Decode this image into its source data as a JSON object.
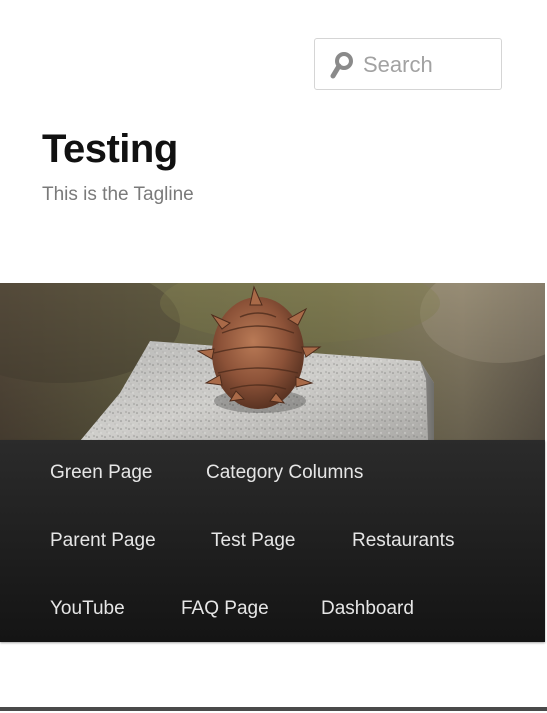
{
  "search": {
    "placeholder": "Search"
  },
  "site": {
    "title": "Testing",
    "tagline": "This is the Tagline"
  },
  "header_image": {
    "subject": "pinecone-on-stone"
  },
  "nav": {
    "items": [
      {
        "label": "Green Page"
      },
      {
        "label": "Category Columns"
      },
      {
        "label": "Parent Page"
      },
      {
        "label": "Test Page"
      },
      {
        "label": "Restaurants"
      },
      {
        "label": "YouTube"
      },
      {
        "label": "FAQ Page"
      },
      {
        "label": "Dashboard"
      }
    ]
  },
  "colors": {
    "nav_background": "#1e1e1e",
    "nav_text": "#e6e6e6",
    "tagline": "#7a7a7a",
    "title": "#111111"
  }
}
